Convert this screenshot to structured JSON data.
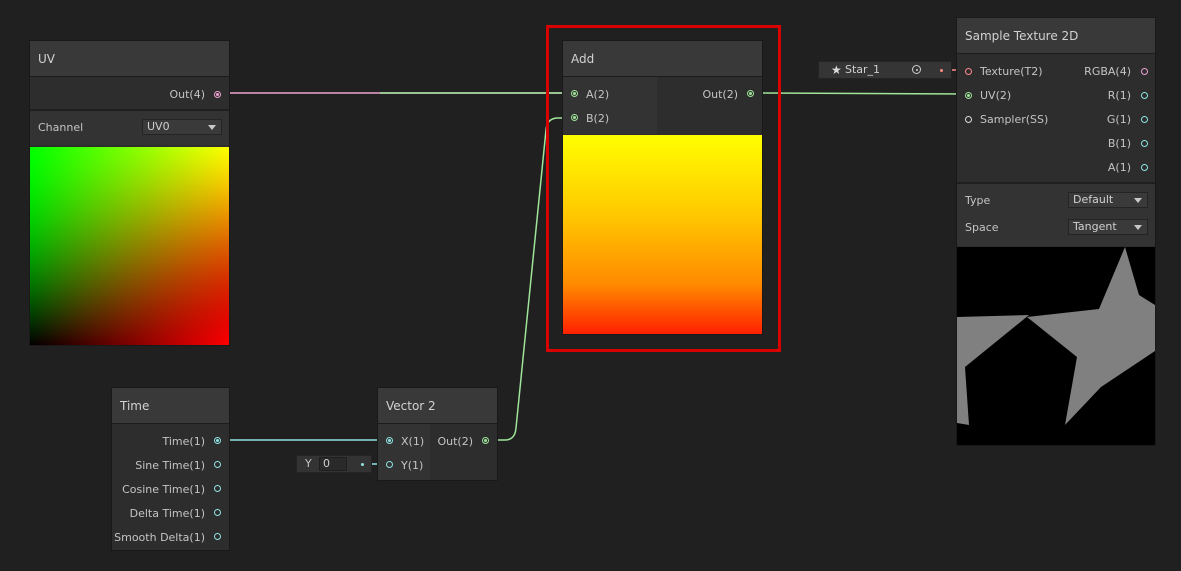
{
  "colors": {
    "background": "#202020",
    "wire_vector4": "#f0a3d1",
    "wire_vector2": "#9fe59a",
    "wire_vector1": "#8fe3e3",
    "highlight": "#d90000"
  },
  "uv_node": {
    "title": "UV",
    "out_label": "Out(4)",
    "channel_label": "Channel",
    "channel_value": "UV0"
  },
  "add_node": {
    "title": "Add",
    "input_a": "A(2)",
    "input_b": "B(2)",
    "output": "Out(2)"
  },
  "sample_texture_node": {
    "title": "Sample Texture 2D",
    "inputs": [
      "Texture(T2)",
      "UV(2)",
      "Sampler(SS)"
    ],
    "outputs": [
      "RGBA(4)",
      "R(1)",
      "G(1)",
      "B(1)",
      "A(1)"
    ],
    "type_label": "Type",
    "type_value": "Default",
    "space_label": "Space",
    "space_value": "Tangent",
    "texture_value": "Star_1"
  },
  "time_node": {
    "title": "Time",
    "outputs": [
      "Time(1)",
      "Sine Time(1)",
      "Cosine Time(1)",
      "Delta Time(1)",
      "Smooth Delta(1)"
    ]
  },
  "vector2_node": {
    "title": "Vector 2",
    "input_x": "X(1)",
    "input_y": "Y(1)",
    "output": "Out(2)",
    "y_field_label": "Y",
    "y_field_value": "0"
  },
  "icons": {
    "texture_icon": "star-icon",
    "texture_picker": "object-picker-icon"
  }
}
